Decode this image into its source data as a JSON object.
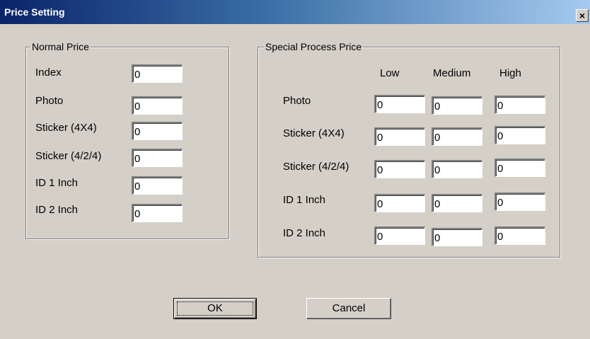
{
  "window": {
    "title": "Price Setting",
    "close_label": "×"
  },
  "normal": {
    "legend": "Normal Price",
    "rows": [
      {
        "label": "Index",
        "value": "0"
      },
      {
        "label": "Photo",
        "value": "0"
      },
      {
        "label": "Sticker (4X4)",
        "value": "0"
      },
      {
        "label": "Sticker (4/2/4)",
        "value": "0"
      },
      {
        "label": "ID 1 Inch",
        "value": "0"
      },
      {
        "label": "ID 2 Inch",
        "value": "0"
      }
    ]
  },
  "special": {
    "legend": "Special Process Price",
    "columns": [
      "Low",
      "Medium",
      "High"
    ],
    "rows": [
      {
        "label": "Photo",
        "low": "0",
        "medium": "0",
        "high": "0"
      },
      {
        "label": "Sticker (4X4)",
        "low": "0",
        "medium": "0",
        "high": "0"
      },
      {
        "label": "Sticker (4/2/4)",
        "low": "0",
        "medium": "0",
        "high": "0"
      },
      {
        "label": "ID 1 Inch",
        "low": "0",
        "medium": "0",
        "high": "0"
      },
      {
        "label": "ID 2 Inch",
        "low": "0",
        "medium": "0",
        "high": "0"
      }
    ]
  },
  "buttons": {
    "ok_label": "OK",
    "cancel_label": "Cancel"
  },
  "colors": {
    "title_start": "#0a246a",
    "title_end": "#a6caf0",
    "face": "#d4d0c8"
  }
}
